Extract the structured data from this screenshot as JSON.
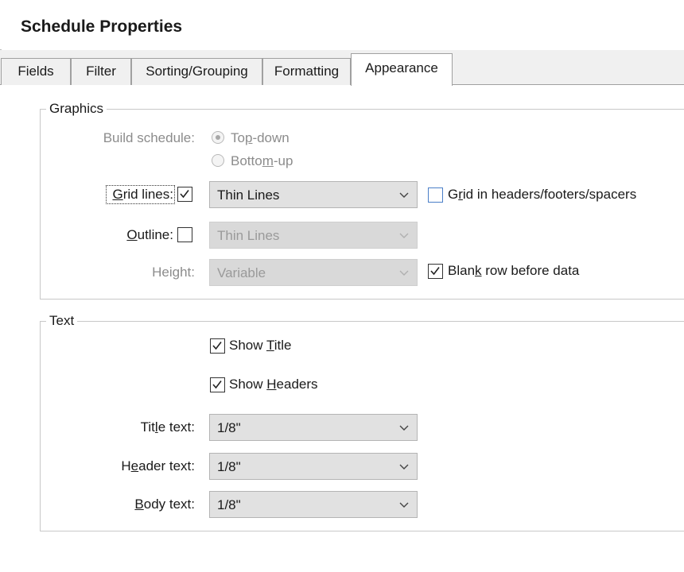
{
  "window": {
    "title": "Schedule Properties"
  },
  "tabs": [
    {
      "label": "Fields",
      "active": false
    },
    {
      "label": "Filter",
      "active": false
    },
    {
      "label": "Sorting/Grouping",
      "active": false
    },
    {
      "label": "Formatting",
      "active": false
    },
    {
      "label": "Appearance",
      "active": true
    }
  ],
  "graphics": {
    "legend": "Graphics",
    "build_schedule_label": "Build schedule:",
    "build_options": [
      {
        "label": "Top-down",
        "selected": true
      },
      {
        "label": "Bottom-up",
        "selected": false
      }
    ],
    "grid_lines": {
      "label": "Grid lines:",
      "checked": true,
      "value": "Thin Lines"
    },
    "grid_headers": {
      "label": "Grid in headers/footers/spacers",
      "checked": false
    },
    "outline": {
      "label": "Outline:",
      "checked": false,
      "value": "Thin Lines"
    },
    "height": {
      "label": "Height:",
      "value": "Variable"
    },
    "blank_row": {
      "label": "Blank row before data",
      "checked": true
    }
  },
  "text": {
    "legend": "Text",
    "show_title": {
      "label": "Show Title",
      "checked": true
    },
    "show_headers": {
      "label": "Show Headers",
      "checked": true
    },
    "title_text": {
      "label": "Title text:",
      "value": "1/8\""
    },
    "header_text": {
      "label": "Header text:",
      "value": "1/8\""
    },
    "body_text": {
      "label": "Body text:",
      "value": "1/8\""
    }
  },
  "colors": {
    "disabled_text": "#8c8c8c",
    "checkbox_blue": "#4a7fc8",
    "dropdown_bg": "#e1e1e1"
  }
}
